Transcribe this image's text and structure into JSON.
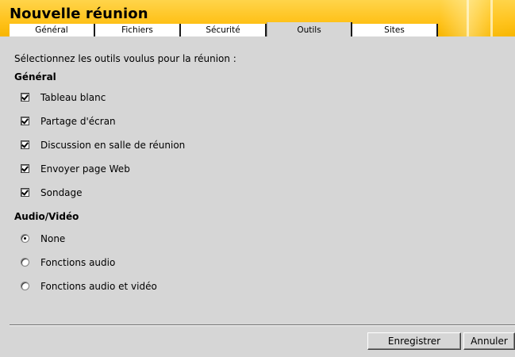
{
  "header": {
    "title": "Nouvelle réunion",
    "tabs": [
      {
        "label": "Général"
      },
      {
        "label": "Fichiers"
      },
      {
        "label": "Sécurité"
      },
      {
        "label": "Outils",
        "active": true
      },
      {
        "label": "Sites"
      }
    ]
  },
  "main": {
    "instruction": "Sélectionnez les outils voulus pour la réunion :",
    "general": {
      "heading": "Général",
      "tools": [
        {
          "label": "Tableau blanc",
          "checked": true
        },
        {
          "label": "Partage d'écran",
          "checked": true
        },
        {
          "label": "Discussion en salle de réunion",
          "checked": true
        },
        {
          "label": "Envoyer page Web",
          "checked": true
        },
        {
          "label": "Sondage",
          "checked": true
        }
      ]
    },
    "audio_video": {
      "heading": "Audio/Vidéo",
      "options": [
        {
          "label": "None",
          "selected": true
        },
        {
          "label": "Fonctions audio",
          "selected": false
        },
        {
          "label": "Fonctions audio et vidéo",
          "selected": false
        }
      ]
    }
  },
  "footer": {
    "save_label": "Enregistrer",
    "cancel_label": "Annuler"
  },
  "colors": {
    "header": "#ffc21a",
    "panel": "#d6d6d6"
  }
}
